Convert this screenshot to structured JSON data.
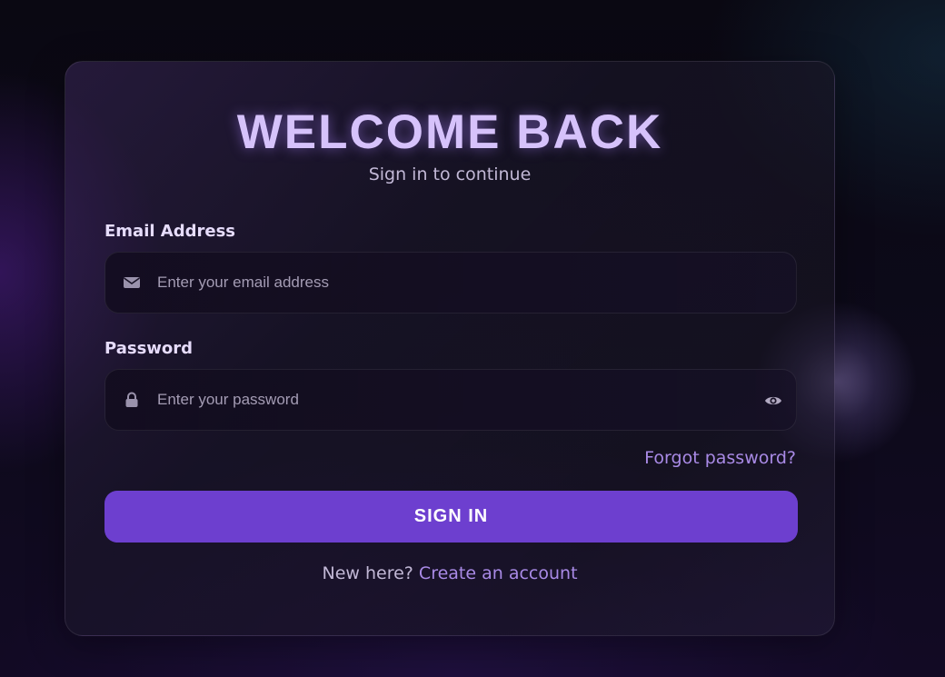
{
  "header": {
    "title": "WELCOME BACK",
    "subtitle": "Sign in to continue"
  },
  "form": {
    "email": {
      "label": "Email Address",
      "placeholder": "Enter your email address",
      "value": "",
      "icon": "envelope-icon"
    },
    "password": {
      "label": "Password",
      "placeholder": "Enter your password",
      "value": "",
      "icon": "lock-icon",
      "toggle_icon": "eye-icon"
    },
    "forgot_label": "Forgot password?",
    "submit_label": "SIGN IN"
  },
  "footer": {
    "prompt": "New here?",
    "link_label": "Create an account"
  },
  "colors": {
    "accent": "#6d3fcf",
    "link": "#a98ae6",
    "title": "#d6c2fb",
    "background": "#0b0913"
  }
}
